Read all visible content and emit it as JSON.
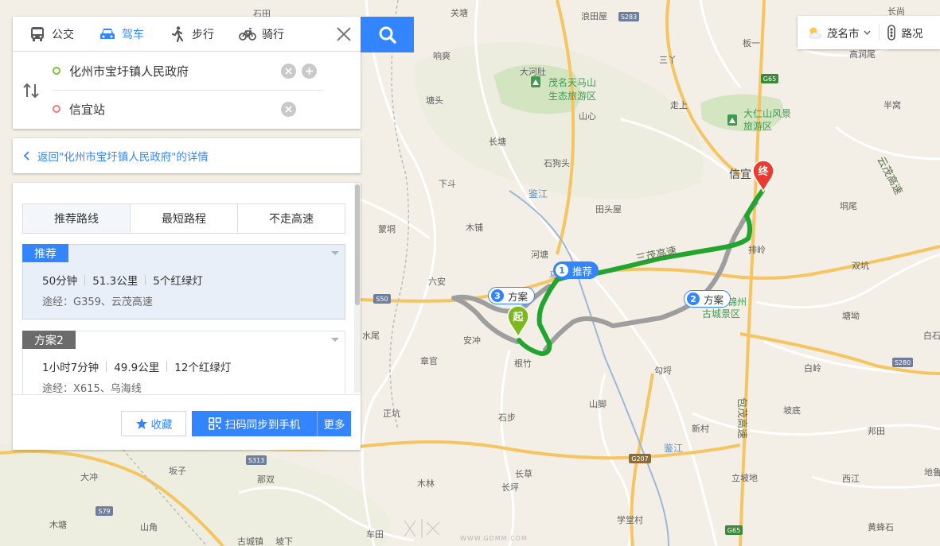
{
  "travel_modes": [
    {
      "label": "公交",
      "icon": "bus-icon"
    },
    {
      "label": "驾车",
      "icon": "car-icon",
      "active": true
    },
    {
      "label": "步行",
      "icon": "walk-icon"
    },
    {
      "label": "骑行",
      "icon": "bike-icon"
    }
  ],
  "route": {
    "start": "化州市宝圩镇人民政府",
    "end": "信宜站"
  },
  "back_link": "返回\"化州市宝圩镇人民政府\"的详情",
  "tabs": [
    "推荐路线",
    "最短路程",
    "不走高速"
  ],
  "plans": [
    {
      "badge": "推荐",
      "duration": "50分钟",
      "distance": "51.3公里",
      "lights": "5个红绿灯",
      "via": "途经：G359、云茂高速"
    },
    {
      "badge": "方案2",
      "duration": "1小时7分钟",
      "distance": "49.9公里",
      "lights": "12个红绿灯",
      "via": "途经：X615、乌海线"
    }
  ],
  "buttons": {
    "favorite": "收藏",
    "send_to_phone": "扫码同步到手机",
    "more": "更多"
  },
  "city_selector": {
    "city": "茂名市",
    "weather_icon": "partly-cloudy-icon"
  },
  "traffic_label": "路况",
  "map_markers": {
    "route1": {
      "num": "1",
      "label": "推荐"
    },
    "route2": {
      "num": "2",
      "label": "方案"
    },
    "route3": {
      "num": "3",
      "label": "方案"
    },
    "start": "起",
    "end": "终"
  },
  "map_labels": {
    "places": [
      "石田",
      "关塘",
      "浪田屋",
      "长尚",
      "响爽",
      "大河肚",
      "三丫",
      "板一",
      "高涧尾",
      "塘头",
      "走上",
      "山心",
      "半窝",
      "长塘",
      "石狗头",
      "下斗",
      "信宜",
      "蒙垌",
      "木铺",
      "田头屋",
      "垌尾",
      "河塘",
      "马竹",
      "六安",
      "双坑",
      "排岭",
      "安冲",
      "塘坳",
      "水尾",
      "章官",
      "根竹",
      "勾埒",
      "白岭",
      "白石",
      "正坑",
      "石步",
      "山脚",
      "坡底",
      "新村",
      "邦田",
      "大冲",
      "坂子",
      "那双",
      "木林",
      "长草",
      "立坡地",
      "西江",
      "长坪",
      "学堂村",
      "地鲁",
      "木塘",
      "山角",
      "车田",
      "古城镇",
      "坡下",
      "黄蜂石"
    ],
    "water": [
      "鉴江",
      "鉴江"
    ],
    "scenic": [
      {
        "name1": "茂名天马山",
        "name2": "生态旅游区",
        "icon": "scenic-area-icon"
      },
      {
        "name1": "大仁山风景",
        "name2": "旅游区",
        "icon": "scenic-area-icon"
      },
      {
        "name1": "锦州",
        "name2": "古城景区",
        "icon": "scenic-area-icon"
      }
    ],
    "highways": [
      "云茂高速",
      "包茂高速",
      "三茂高速"
    ],
    "shields": [
      "S283",
      "G65",
      "S50",
      "S280",
      "S313",
      "S79",
      "G207",
      "G65"
    ]
  },
  "watermark": {
    "text": "WWW.GDMM.COM",
    "logo": "site-logo-icon"
  }
}
